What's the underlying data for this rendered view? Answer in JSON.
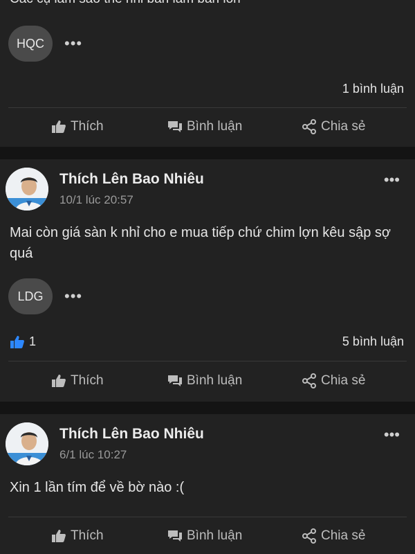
{
  "post_top": {
    "cut_text": "Các cụ làm sao thế nhỉ bán lâm bán lỗn",
    "chip": "HQC",
    "comments": "1 bình luận"
  },
  "post1": {
    "author": "Thích Lên Bao Nhiêu",
    "time": "10/1 lúc 20:57",
    "text": "Mai còn giá sàn k nhỉ cho e mua tiếp chứ chim lợn kêu sập sợ quá",
    "chip": "LDG",
    "likes": "1",
    "comments": "5 bình luận"
  },
  "post2": {
    "author": "Thích Lên Bao Nhiêu",
    "time": "6/1 lúc 10:27",
    "text": "Xin 1 lần tím để về bờ nào :("
  },
  "actions": {
    "like": "Thích",
    "comment": "Bình luận",
    "share": "Chia sẻ"
  },
  "more": "•••",
  "colors": {
    "card": "#222222",
    "separator": "#141414",
    "like_accent": "#2d88ff"
  }
}
